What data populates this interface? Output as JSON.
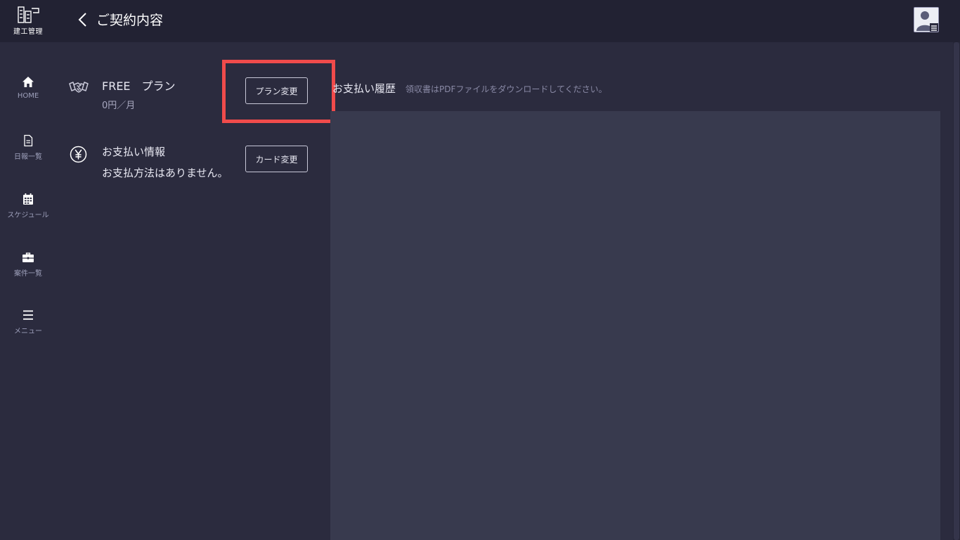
{
  "header": {
    "logo_text": "建工管理",
    "title": "ご契約内容",
    "icons": {
      "back": "chevron-left-icon",
      "avatar": "user-avatar-icon"
    }
  },
  "sidebar": {
    "items": [
      {
        "label": "HOME",
        "icon": "home-icon"
      },
      {
        "label": "日報一覧",
        "icon": "document-icon"
      },
      {
        "label": "スケジュール",
        "icon": "calendar-icon"
      },
      {
        "label": "案件一覧",
        "icon": "briefcase-icon"
      },
      {
        "label": "メニュー",
        "icon": "menu-icon"
      }
    ]
  },
  "plan": {
    "name": "FREE　プラン",
    "price": "0円／月",
    "change_button": "プラン変更",
    "icon": "handshake-icon"
  },
  "payment_info": {
    "title": "お支払い情報",
    "status": "お支払方法はありません。",
    "change_button": "カード変更",
    "icon": "yen-icon"
  },
  "payment_history": {
    "title": "お支払い履歴",
    "note": "領収書はPDFファイルをダウンロードしてください。"
  },
  "colors": {
    "background": "#2b2b3e",
    "header": "#222233",
    "panel": "#383a4e",
    "highlight": "#f04b4b"
  }
}
